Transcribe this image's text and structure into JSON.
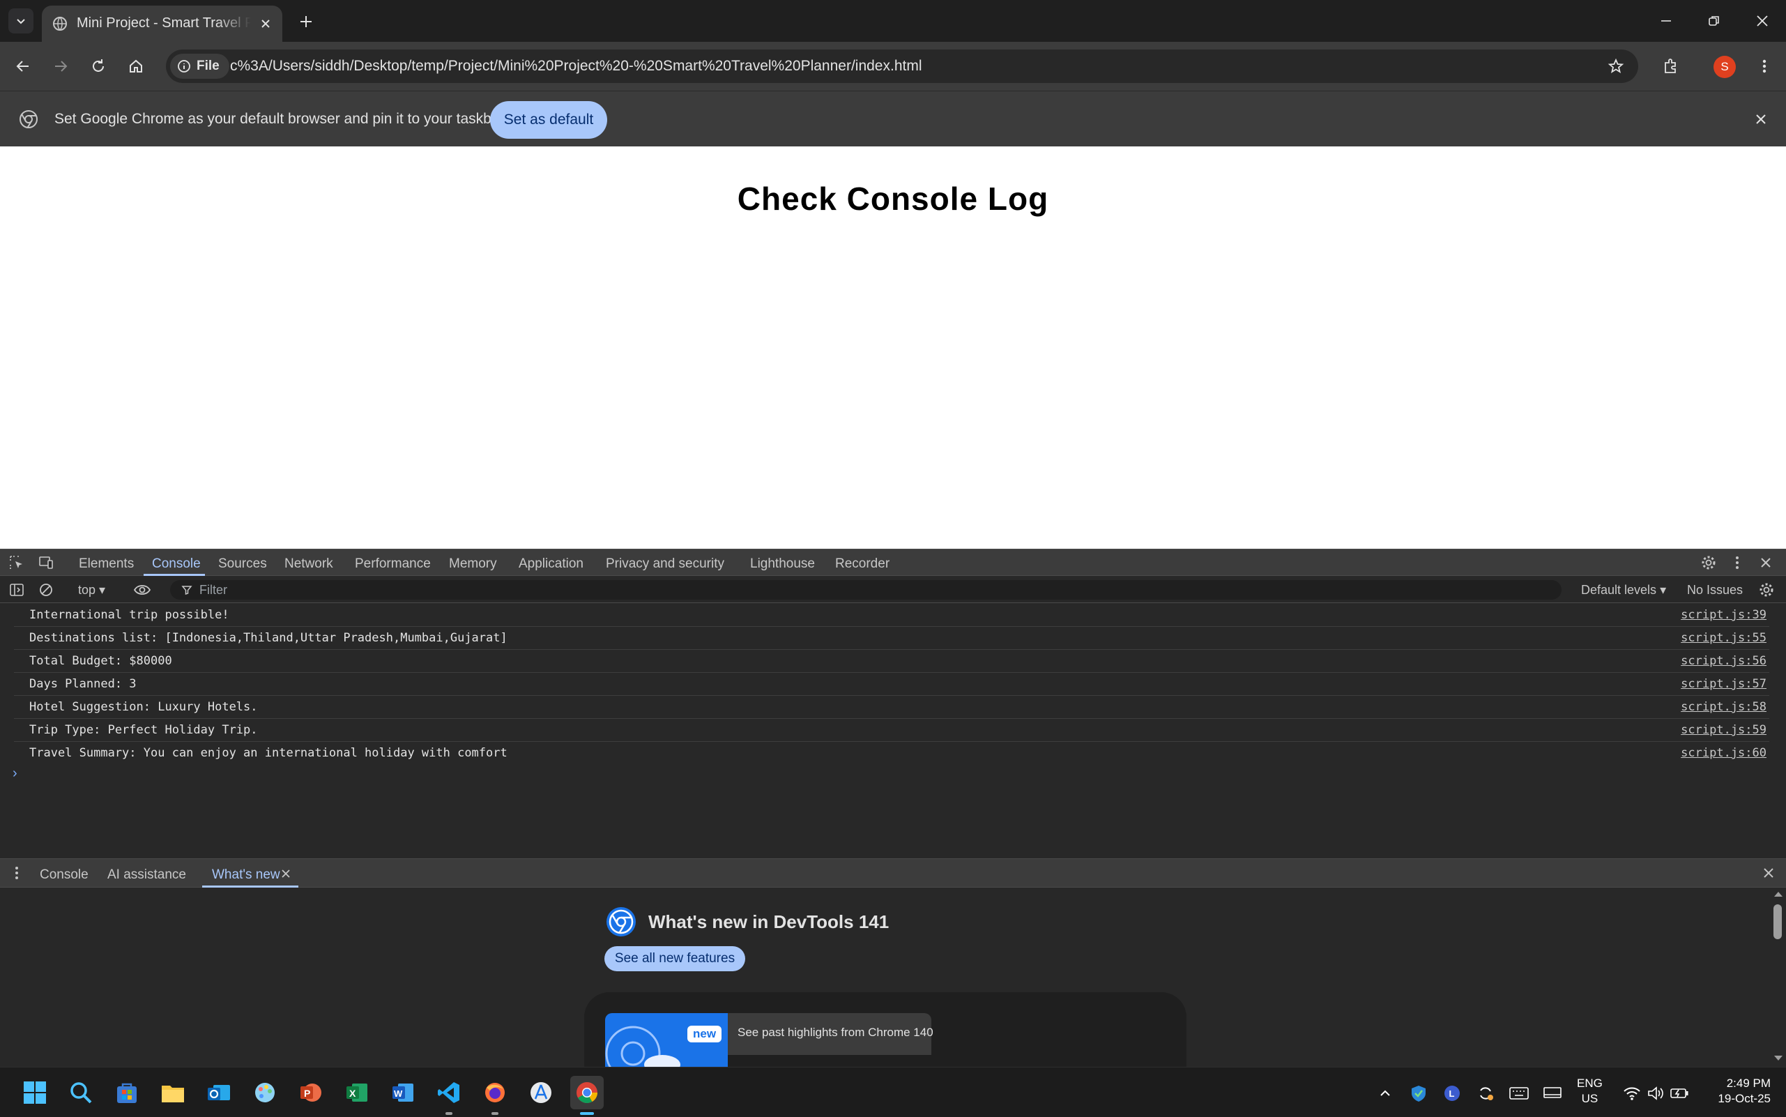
{
  "browser": {
    "tab_title": "Mini Project - Smart Travel Planner",
    "security_chip": "File",
    "url": "c%3A/Users/siddh/Desktop/temp/Project/Mini%20Project%20-%20Smart%20Travel%20Planner/index.html",
    "profile_initial": "S",
    "accent": "#a8c7fa"
  },
  "infobar": {
    "message": "Set Google Chrome as your default browser and pin it to your taskbar",
    "button": "Set as default"
  },
  "page": {
    "heading": "Check Console Log"
  },
  "devtools": {
    "tabs": [
      "Elements",
      "Console",
      "Sources",
      "Network",
      "Performance",
      "Memory",
      "Application",
      "Privacy and security",
      "Lighthouse",
      "Recorder"
    ],
    "active_tab": "Console",
    "context": "top",
    "filter_placeholder": "Filter",
    "levels": "Default levels",
    "issues": "No Issues",
    "logs": [
      {
        "message": "International trip possible!",
        "source": "script.js:39"
      },
      {
        "message": "Destinations list: [Indonesia,Thiland,Uttar Pradesh,Mumbai,Gujarat]",
        "source": "script.js:55"
      },
      {
        "message": "Total Budget: $80000",
        "source": "script.js:56"
      },
      {
        "message": "Days Planned: 3",
        "source": "script.js:57"
      },
      {
        "message": "Hotel Suggestion: Luxury Hotels.",
        "source": "script.js:58"
      },
      {
        "message": "Trip Type: Perfect Holiday Trip.",
        "source": "script.js:59"
      },
      {
        "message": "Travel Summary: You can enjoy an international holiday with comfort",
        "source": "script.js:60"
      }
    ],
    "drawer_tabs": [
      "Console",
      "AI assistance",
      "What's new"
    ],
    "drawer_active": "What's new",
    "whats_new": {
      "title": "What's new in DevTools 141",
      "button": "See all new features",
      "badge": "new",
      "past_highlights": "See past highlights from Chrome 140"
    }
  },
  "taskbar": {
    "apps": [
      "start-icon",
      "search-icon",
      "store-icon",
      "file-explorer-icon",
      "outlook-icon",
      "paint-icon",
      "powerpoint-icon",
      "excel-icon",
      "word-icon",
      "vscode-icon",
      "firefox-icon",
      "app-store-icon",
      "chrome-icon"
    ],
    "lang_top": "ENG",
    "lang_bottom": "US",
    "time": "2:49 PM",
    "date": "19-Oct-25"
  }
}
